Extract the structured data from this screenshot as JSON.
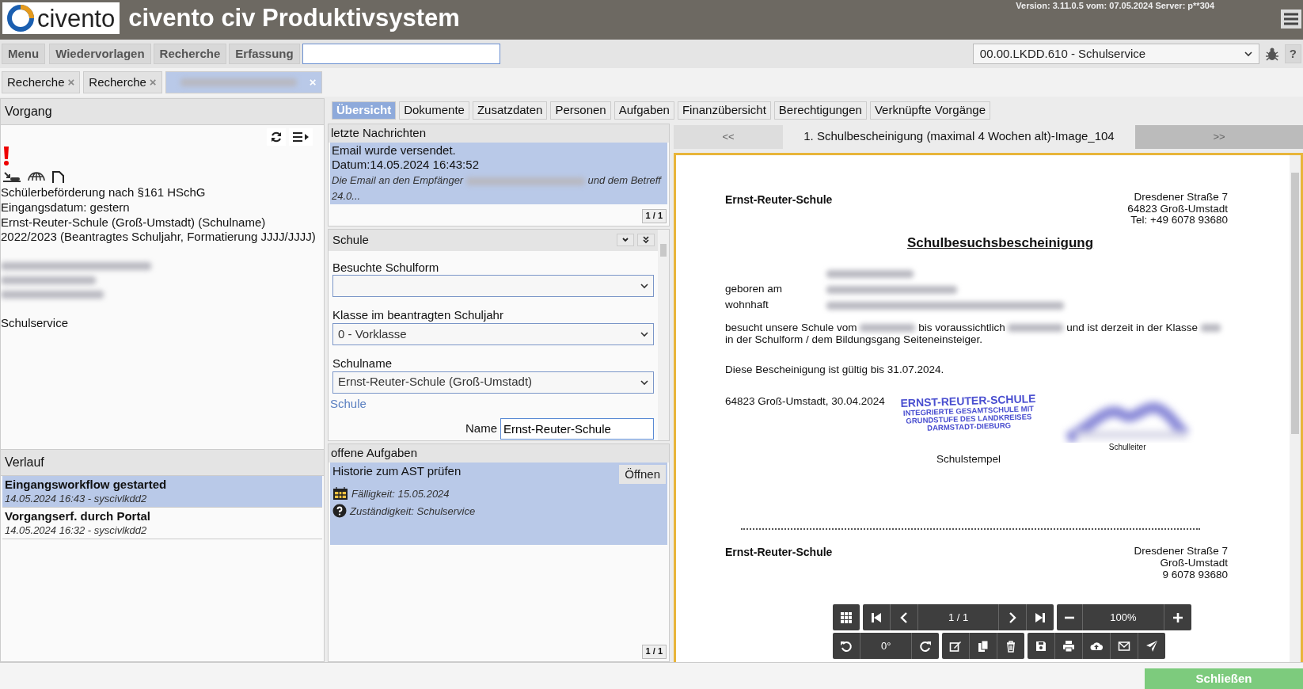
{
  "header": {
    "logo_text": "civento",
    "title": "civento civ Produktivsystem",
    "version": "Version: 3.11.0.5 vom: 07.05.2024 Server: p**304"
  },
  "toolbar": {
    "buttons": [
      "Menu",
      "Wiedervorlagen",
      "Recherche",
      "Erfassung"
    ],
    "mandant": "00.00.LKDD.610 - Schulservice",
    "help": "?"
  },
  "open_tabs": [
    {
      "kind": "text",
      "label": "Recherche",
      "close": "×",
      "selected": false
    },
    {
      "kind": "text",
      "label": "Recherche",
      "close": "×",
      "selected": false
    },
    {
      "kind": "redacted",
      "close": "×",
      "selected": true
    }
  ],
  "vorgang": {
    "title": "Vorgang",
    "summary": [
      "Schülerbeförderung nach §161 HSchG",
      "Eingangsdatum: gestern",
      "Ernst-Reuter-Schule (Groß-Umstadt) (Schulname)",
      "2022/2023 (Beantragtes Schuljahr, Formatierung JJJJ/JJJJ)"
    ],
    "contact": [
      {
        "kind": "redacted"
      },
      {
        "kind": "redacted"
      },
      {
        "kind": "redacted"
      }
    ],
    "department": "Schulservice"
  },
  "verlauf": {
    "title": "Verlauf",
    "items": [
      {
        "title": "Eingangsworkflow gestarted",
        "meta": "14.05.2024 16:43 - syscivlkdd2",
        "selected": true
      },
      {
        "title": "Vorgangserf. durch Portal",
        "meta": "14.05.2024 16:32 - syscivlkdd2",
        "selected": false
      }
    ]
  },
  "detail_tabs": [
    {
      "label": "Übersicht",
      "selected": true
    },
    {
      "label": "Dokumente",
      "selected": false
    },
    {
      "label": "Zusatzdaten",
      "selected": false
    },
    {
      "label": "Personen",
      "selected": false
    },
    {
      "label": "Aufgaben",
      "selected": false
    },
    {
      "label": "Finanzübersicht",
      "selected": false
    },
    {
      "label": "Berechtigungen",
      "selected": false
    },
    {
      "label": "Verknüpfte Vorgänge",
      "selected": false
    }
  ],
  "messages": {
    "title": "letzte Nachrichten",
    "items": [
      {
        "subject": "Email wurde versendet.",
        "date": "Datum:14.05.2024 16:43:52",
        "preview_before": "Die Email an den Empfänger",
        "preview_after": "und dem Betreff 24.0...",
        "selected": true
      }
    ],
    "pager": "1 / 1"
  },
  "schule": {
    "title": "Schule",
    "fields": [
      {
        "label": "Besuchte Schulform"
      },
      {
        "label": "Klasse im beantragten Schuljahr",
        "value": "0 - Vorklasse"
      },
      {
        "label": "Schulname",
        "value": "Ernst-Reuter-Schule (Groß-Umstadt)"
      }
    ],
    "subsection": "Schule",
    "name_label": "Name",
    "name_value": "Ernst-Reuter-Schule"
  },
  "tasks": {
    "title": "offene Aufgaben",
    "items": [
      {
        "title": "Historie zum AST prüfen",
        "button": "Öffnen",
        "due": "Fälligkeit: 15.05.2024",
        "owner": "Zuständigkeit: Schulservice"
      }
    ],
    "pager": "1 / 1"
  },
  "viewer": {
    "prev": "<<",
    "next": ">>",
    "title": "1. Schulbescheinigung (maximal 4 Wochen alt)-Image_104",
    "document": {
      "school": "Ernst-Reuter-Schule",
      "address": [
        "Dresdener Straße 7",
        "64823 Groß-Umstadt",
        "Tel: +49 6078 93680"
      ],
      "heading": "Schulbesuchsbescheinigung",
      "person_rows": [
        {
          "label": ""
        },
        {
          "label": "geboren am"
        },
        {
          "label": "wohnhaft"
        }
      ],
      "body_parts": [
        "besucht unsere Schule vom",
        "bis voraussichtlich",
        "und ist derzeit in der Klasse",
        "in der Schulform / dem Bildungsgang Seiteneinsteiger."
      ],
      "validity": "Diese Bescheinigung ist gültig bis 31.07.2024.",
      "place_date": "64823 Groß-Umstadt, 30.04.2024",
      "stamp": [
        "ERNST-REUTER-SCHULE",
        "INTEGRIERTE GESAMTSCHULE MIT",
        "GRUNDSTUFE DES LANDKREISES",
        "DARMSTADT-DIEBURG"
      ],
      "stamp_caption": "Schulstempel",
      "signature_caption": "Schulleiter",
      "page2_school": "Ernst-Reuter-Schule",
      "page2_address": [
        "Dresdener Straße 7",
        "Groß-Umstadt",
        "9 6078 93680"
      ]
    },
    "controls": {
      "page": "1 / 1",
      "zoom": "100%",
      "rotation": "0°"
    }
  },
  "footer": {
    "close": "Schließen"
  }
}
